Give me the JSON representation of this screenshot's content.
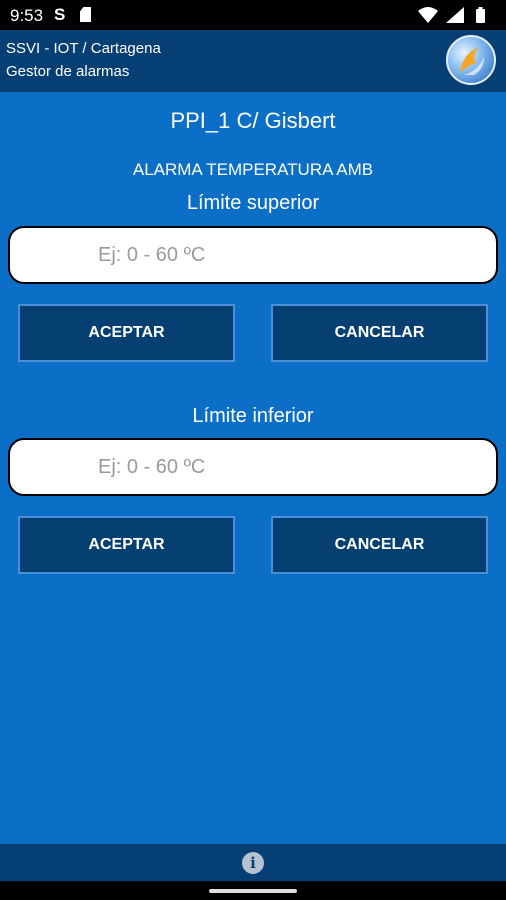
{
  "status_bar": {
    "time": "9:53",
    "s_glyph": "S",
    "icons": [
      "sd-card-icon",
      "wifi-icon",
      "signal-icon",
      "battery-icon"
    ]
  },
  "app_bar": {
    "line1": "SSVI - IOT / Cartagena",
    "line2": "Gestor de alarmas",
    "logo_icon": "app-logo-icon"
  },
  "main": {
    "title": "PPI_1 C/ Gisbert",
    "subtitle": "ALARMA TEMPERATURA AMB",
    "upper": {
      "label": "Límite superior",
      "placeholder": "Ej: 0 - 60 ºC",
      "value": "",
      "accept": "ACEPTAR",
      "cancel": "CANCELAR"
    },
    "lower": {
      "label": "Límite inferior",
      "placeholder": "Ej: 0 - 60 ºC",
      "value": "",
      "accept": "ACEPTAR",
      "cancel": "CANCELAR"
    }
  },
  "bottom_bar": {
    "info_glyph": "i"
  },
  "colors": {
    "background": "#0b6fc7",
    "bar": "#053f74",
    "button": "#063f72",
    "button_border": "#4a8fd8"
  }
}
